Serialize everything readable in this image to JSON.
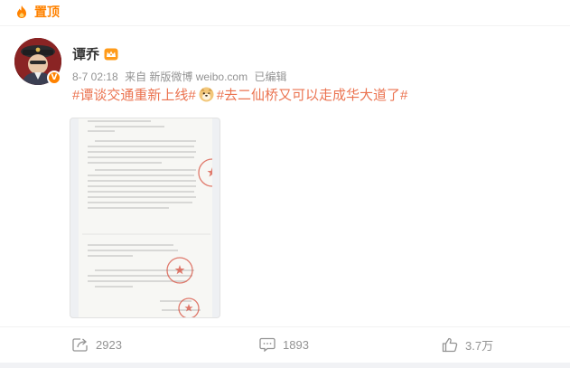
{
  "pin": {
    "label": "置顶",
    "icon": "pin-flame-icon"
  },
  "author": {
    "name": "谭乔",
    "avatar_icon": "avatar",
    "verified_icon": "verified-v-icon",
    "member_icon": "member-crown-icon"
  },
  "meta": {
    "time": "8-7 02:18",
    "source": "来自 新版微博 weibo.com",
    "edited": "已编辑"
  },
  "content": {
    "topic1": "#谭谈交通重新上线#",
    "emoji": "doge-emoji-icon",
    "topic2": "#去二仙桥又可以走成华大道了#"
  },
  "image": {
    "type": "document-scan-thumbnail"
  },
  "actions": {
    "repost": {
      "icon": "repost-icon",
      "count": "2923"
    },
    "comment": {
      "icon": "comment-icon",
      "count": "1893"
    },
    "like": {
      "icon": "like-thumb-icon",
      "count": "3.7万"
    }
  },
  "colors": {
    "accent": "#ff8200",
    "topic": "#eb7350",
    "meta_text": "#939393",
    "seal": "#d8503f"
  }
}
